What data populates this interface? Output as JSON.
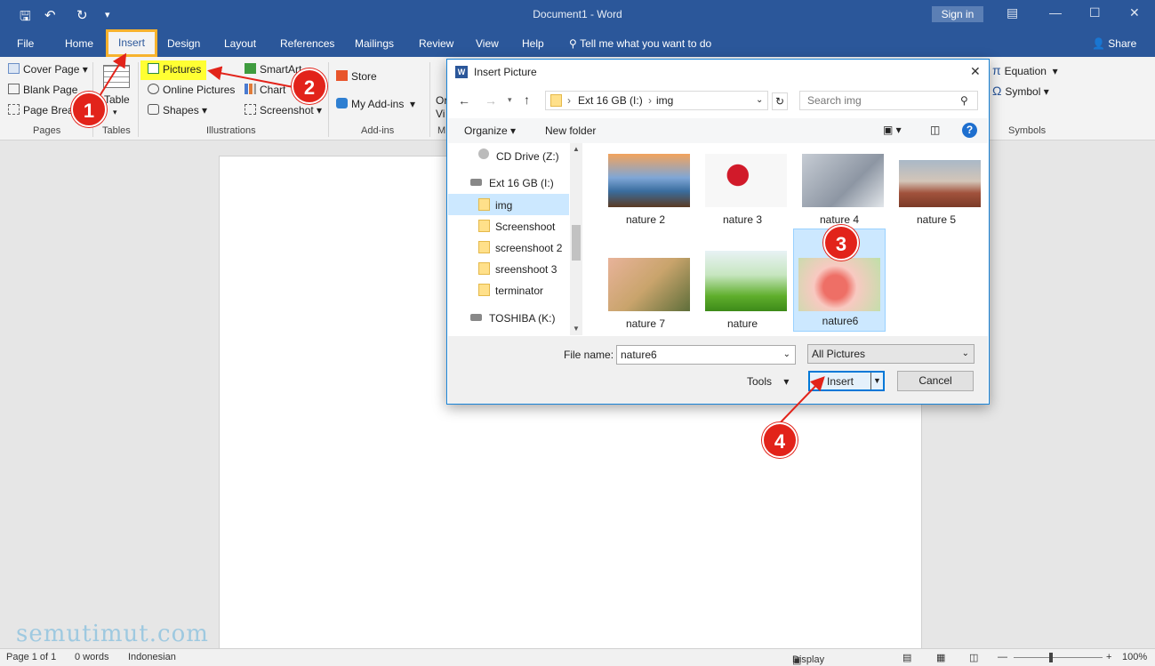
{
  "titlebar": {
    "doc_title": "Document1 - Word",
    "signin": "Sign in"
  },
  "menu": {
    "file": "File",
    "home": "Home",
    "insert": "Insert",
    "design": "Design",
    "layout": "Layout",
    "references": "References",
    "mailings": "Mailings",
    "review": "Review",
    "view": "View",
    "help": "Help",
    "tellme": "Tell me what you want to do",
    "share": "Share"
  },
  "ribbon": {
    "cover_page": "Cover Page",
    "blank_page": "Blank Page",
    "page_break": "Page Break",
    "pages_label": "Pages",
    "table": "Table",
    "tables_label": "Tables",
    "pictures": "Pictures",
    "online_pictures": "Online Pictures",
    "shapes": "Shapes",
    "smartart": "SmartArt",
    "chart": "Chart",
    "screenshot": "Screenshot",
    "illustrations_label": "Illustrations",
    "store": "Store",
    "my_addins": "My Add-ins",
    "addins_label": "Add-ins",
    "equation": "Equation",
    "symbol": "Symbol",
    "symbols_label": "Symbols",
    "partial_media_1": "Or",
    "partial_media_2": "Vi",
    "partial_media_label": "M"
  },
  "dialog": {
    "title": "Insert Picture",
    "path": [
      "Ext 16 GB (I:)",
      "img"
    ],
    "search_placeholder": "Search img",
    "organize": "Organize",
    "new_folder": "New folder",
    "nav": [
      {
        "label": "CD Drive (Z:)",
        "kind": "drive"
      },
      {
        "label": "Ext 16 GB (I:)",
        "kind": "drive"
      },
      {
        "label": "img",
        "kind": "folder"
      },
      {
        "label": "Screenshoot",
        "kind": "folder"
      },
      {
        "label": "screenshoot 2",
        "kind": "folder"
      },
      {
        "label": "sreenshoot 3",
        "kind": "folder"
      },
      {
        "label": "terminator",
        "kind": "folder"
      },
      {
        "label": "TOSHIBA (K:)",
        "kind": "drive"
      }
    ],
    "files": [
      "nature 2",
      "nature 3",
      "nature 4",
      "nature 5",
      "nature 7",
      "nature",
      "nature6"
    ],
    "selected_file": "nature6",
    "file_name_label": "File name:",
    "file_name_value": "nature6",
    "filter": "All Pictures",
    "tools": "Tools",
    "insert": "Insert",
    "cancel": "Cancel"
  },
  "status": {
    "page": "Page 1 of 1",
    "words": "0 words",
    "language": "Indonesian",
    "display_settings": "Display Settings",
    "zoom": "100%"
  },
  "annotations": [
    "1",
    "2",
    "3",
    "4"
  ],
  "watermark": "semutimut.com",
  "colors": {
    "word_blue": "#2b579a",
    "callout_red": "#e2231a",
    "highlight_yellow": "#ffff33",
    "selection_blue": "#cce8ff"
  }
}
